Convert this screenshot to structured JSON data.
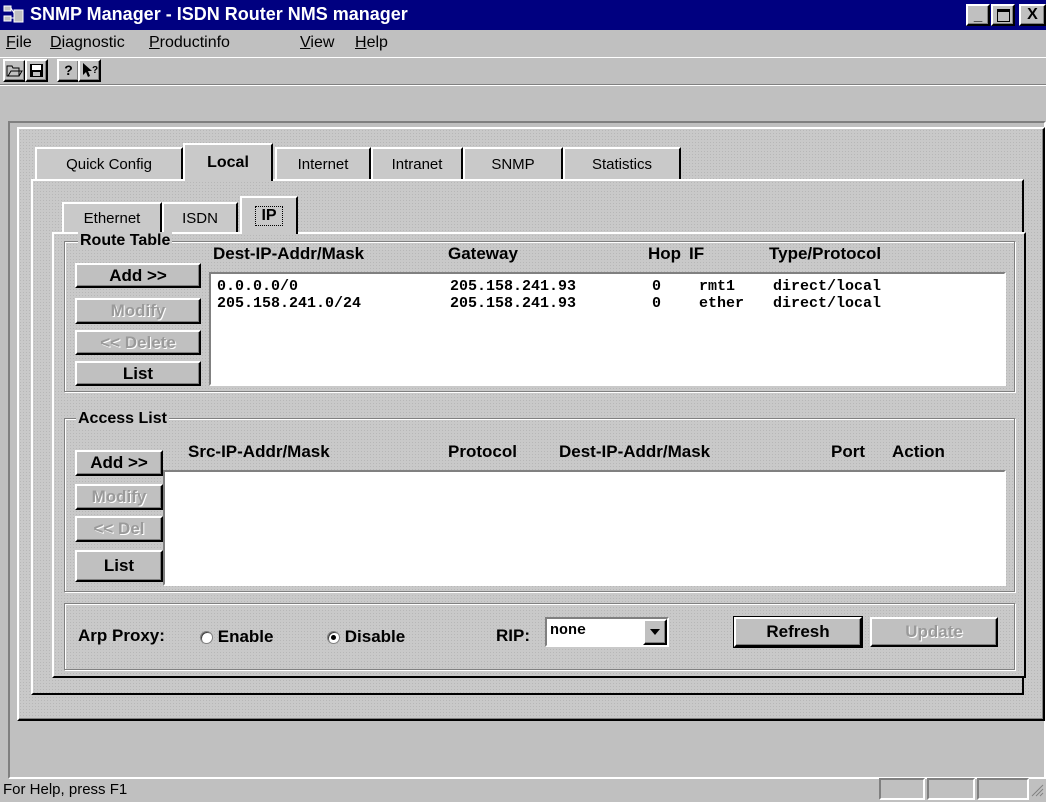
{
  "window": {
    "title": "SNMP Manager - ISDN Router NMS manager",
    "controls": {
      "minimize": "_",
      "maximize": "□",
      "close": "X"
    }
  },
  "menu": {
    "items": [
      {
        "label": "File",
        "mnemonic": "F",
        "rest": "ile"
      },
      {
        "label": "Diagnostic",
        "mnemonic": "D",
        "rest": "iagnostic"
      },
      {
        "label": "Productinfo",
        "mnemonic": "P",
        "rest": "roductinfo"
      },
      {
        "label": "View",
        "mnemonic": "V",
        "rest": "iew"
      },
      {
        "label": "Help",
        "mnemonic": "H",
        "rest": "elp"
      }
    ]
  },
  "toolbar": {
    "icons": [
      "open-folder-icon",
      "save-disk-icon",
      "about-help-icon",
      "context-help-icon"
    ]
  },
  "main_tabs": [
    "Quick Config",
    "Local",
    "Internet",
    "Intranet",
    "SNMP",
    "Statistics"
  ],
  "main_tabs_active": "Local",
  "sub_tabs": [
    "Ethernet",
    "ISDN",
    "IP"
  ],
  "sub_tabs_active": "IP",
  "route_table": {
    "legend": "Route Table",
    "headers": {
      "dest": "Dest-IP-Addr/Mask",
      "gateway": "Gateway",
      "hop": "Hop",
      "if": "IF",
      "type": "Type/Protocol"
    },
    "buttons": {
      "add": "Add >>",
      "modify": "Modify",
      "delete": "<< Delete",
      "list": "List"
    },
    "rows": [
      {
        "dest": "0.0.0.0/0",
        "gateway": "205.158.241.93",
        "hop": "0",
        "if": "rmt1",
        "type": "direct/local"
      },
      {
        "dest": "205.158.241.0/24",
        "gateway": "205.158.241.93",
        "hop": "0",
        "if": "ether",
        "type": "direct/local"
      }
    ]
  },
  "access_list": {
    "legend": "Access List",
    "headers": {
      "src": "Src-IP-Addr/Mask",
      "protocol": "Protocol",
      "dest": "Dest-IP-Addr/Mask",
      "port": "Port",
      "action": "Action"
    },
    "buttons": {
      "add": "Add >>",
      "modify": "Modify",
      "delete": "<< Del",
      "list": "List"
    },
    "rows": []
  },
  "options": {
    "arp_label": "Arp Proxy:",
    "enable_label": "Enable",
    "disable_label": "Disable",
    "arp_selected": "Disable",
    "rip_label": "RIP:",
    "rip_value": "none",
    "refresh_label": "Refresh",
    "update_label": "Update"
  },
  "status_bar": {
    "text": "For Help, press F1"
  },
  "colors": {
    "title_bar": "#000080",
    "face": "#c0c0c0",
    "window_bg": "#ffffff",
    "disabled_text": "#9a9a9a"
  }
}
